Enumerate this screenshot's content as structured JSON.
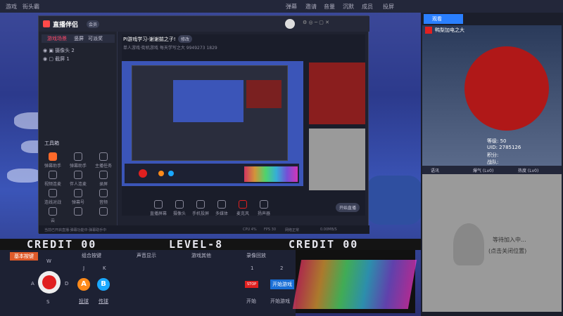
{
  "topbar": {
    "left": [
      "游戏",
      "街头霸"
    ],
    "right": [
      "弹幕",
      "邀请",
      "音量",
      "沉默",
      "成员",
      "投屏"
    ]
  },
  "app": {
    "name": "直播伴侣",
    "badge": "会员",
    "tabs": [
      "游戏场景",
      "竖屏",
      "可派奖"
    ],
    "scenes": [
      "摄像头 2",
      "截屏 1"
    ],
    "title": "PI游戏学习-谢谢揣之子!",
    "title_edit": "修改",
    "subtitle": [
      "单人游戏·街机游戏",
      "每天学写之大",
      "9949273",
      "1829"
    ],
    "tools_header": "工具箱",
    "tools": [
      "弹幕助手",
      "弹幕助手",
      "主播任务",
      "视频连麦",
      "伴人连麦",
      "录屏",
      "连线对战",
      "弹幕号",
      "音频",
      "云",
      "",
      ""
    ],
    "bottom_tools": [
      "直播屏幕",
      "摄像头",
      "手机投屏",
      "多媒体",
      "麦克风",
      "扬声器"
    ],
    "go_live": "开始直播",
    "status": [
      "当前已开启直播·弹幕功能中·弹幕助手中",
      "CPU 4%",
      "FPS 30",
      "网络正常",
      "0.00MB/S"
    ]
  },
  "game": {
    "credit_left": "CREDIT  00",
    "level": "LEVEL-8",
    "credit_right": "CREDIT  00"
  },
  "panel": {
    "tabs": [
      "基本按键",
      "组合按键",
      "声音显示",
      "游戏其他",
      "录像回放"
    ],
    "dpad": [
      "W",
      "A",
      "S",
      "D"
    ],
    "keys": [
      "J",
      "K"
    ],
    "key_labels": [
      "投球",
      "传球"
    ],
    "slots": [
      "1",
      "2"
    ],
    "start_btn": "开始游戏",
    "start_small": "开始",
    "start_stop": "STOP",
    "start_label": "开始游戏"
  },
  "right": {
    "header": "观看",
    "player_name": "鸭梨加电之大",
    "stats": [
      "等级: 50",
      "UID: 2785126",
      "积分:",
      "战队:"
    ],
    "footer": [
      "语讯",
      "爆气 (Lv0)",
      "热度 (Lv0)"
    ],
    "waiting": "等待加入中...",
    "waiting_sub": "(点击关闭位置)"
  },
  "colors": {
    "accent": "#2a7fff",
    "red": "#e02020",
    "orange": "#ff8a1a",
    "blue": "#1aa8ff"
  }
}
